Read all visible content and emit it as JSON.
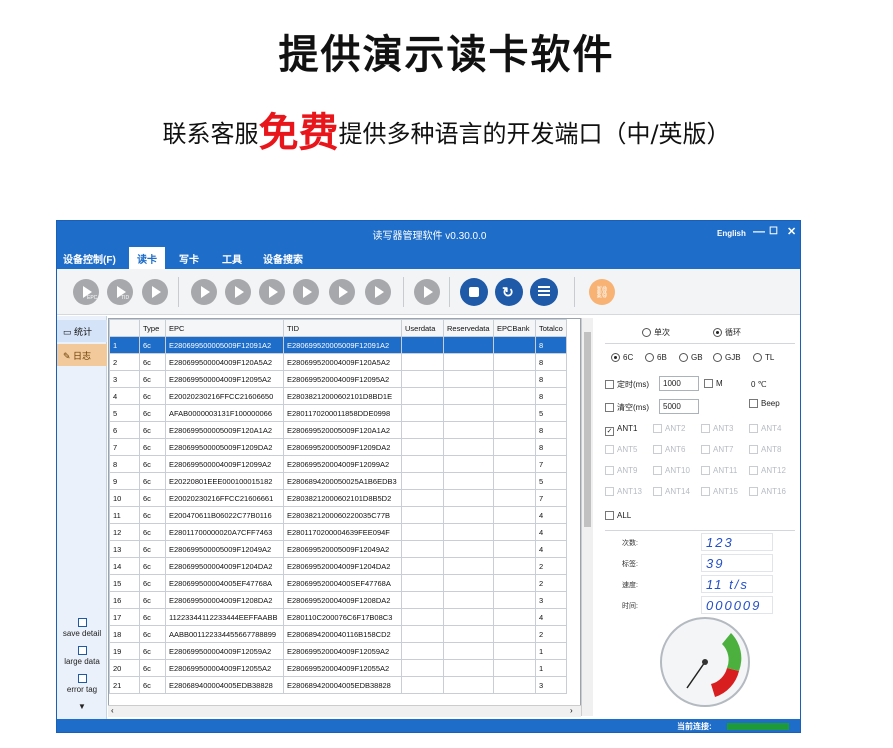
{
  "header": {
    "title": "提供演示读卡软件",
    "subtitle_pre": "联系客服",
    "subtitle_highlight": "免费",
    "subtitle_post": "提供多种语言的开发端口（中/英版）"
  },
  "window": {
    "title": "读写器管理软件 v0.30.0.0",
    "language": "English",
    "min": "—",
    "max": "☐",
    "close": "✕"
  },
  "menu": {
    "device_control": "设备控制(F)",
    "read": "读卡",
    "write": "写卡",
    "tools": "工具",
    "search": "设备搜索"
  },
  "toolbar": {
    "epc_label": "EPC",
    "tid_label": "TID"
  },
  "sidebar": {
    "stats": "统计",
    "log": "日志",
    "save_detail": "save detail",
    "large_data": "large data",
    "error_tag": "error tag"
  },
  "table": {
    "headers": [
      "",
      "Type",
      "EPC",
      "TID",
      "Userdata",
      "Reservedata",
      "EPCBank",
      "Totalco"
    ],
    "rows": [
      [
        "1",
        "6c",
        "E280699500005009F12091A2",
        "E280699520005009F12091A2",
        "8"
      ],
      [
        "2",
        "6c",
        "E280699500004009F120A5A2",
        "E280699520004009F120A5A2",
        "8"
      ],
      [
        "3",
        "6c",
        "E280699500004009F12095A2",
        "E280699520004009F12095A2",
        "8"
      ],
      [
        "4",
        "6c",
        "E20020230216FFCC21606650",
        "E28038212000602101D8BD1E",
        "8"
      ],
      [
        "5",
        "6c",
        "AFAB0000003131F100000066",
        "E2801170200011858DDE0998",
        "5"
      ],
      [
        "6",
        "6c",
        "E280699500005009F120A1A2",
        "E280699520005009F120A1A2",
        "8"
      ],
      [
        "7",
        "6c",
        "E280699500005009F1209DA2",
        "E280699520005009F1209DA2",
        "8"
      ],
      [
        "8",
        "6c",
        "E280699500004009F12099A2",
        "E280699520004009F12099A2",
        "7"
      ],
      [
        "9",
        "6c",
        "E20220801EEE000100015182",
        "E2806894200050025A1B6EDB3",
        "5"
      ],
      [
        "10",
        "6c",
        "E20020230216FFCC21606661",
        "E28038212000602101D8B5D2",
        "7"
      ],
      [
        "11",
        "6c",
        "E200470611B06022C77B0116",
        "E2803821200060220035C77B",
        "4"
      ],
      [
        "12",
        "6c",
        "E28011700000020A7CFF7463",
        "E2801170200004639FEE094F",
        "4"
      ],
      [
        "13",
        "6c",
        "E280699500005009F12049A2",
        "E280699520005009F12049A2",
        "4"
      ],
      [
        "14",
        "6c",
        "E280699500004009F1204DA2",
        "E280699520004009F1204DA2",
        "2"
      ],
      [
        "15",
        "6c",
        "E280699500004005EF47768A",
        "E28069952000400SEF47768A",
        "2"
      ],
      [
        "16",
        "6c",
        "E280699500004009F1208DA2",
        "E280699520004009F1208DA2",
        "3"
      ],
      [
        "17",
        "6c",
        "11223344112233444EEFFAABB",
        "E280110C200076C6F17B08C3",
        "4"
      ],
      [
        "18",
        "6c",
        "AABB001122334455667788899",
        "E2806894200040116B158CD2",
        "2"
      ],
      [
        "19",
        "6c",
        "E280699500004009F12059A2",
        "E280699520004009F12059A2",
        "1"
      ],
      [
        "20",
        "6c",
        "E280699500004009F12055A2",
        "E280699520004009F12055A2",
        "1"
      ],
      [
        "21",
        "6c",
        "E280689400004005EDB38828",
        "E280689420004005EDB38828",
        "3"
      ]
    ]
  },
  "panel": {
    "single": "单次",
    "loop": "循环",
    "protocols": [
      "6C",
      "6B",
      "GB",
      "GJB",
      "TL"
    ],
    "timed_label": "定时(ms)",
    "timed_value": "1000",
    "m_label": "M",
    "temp": "0 ℃",
    "clear_label": "清空(ms)",
    "clear_value": "5000",
    "beep": "Beep",
    "antennas": [
      "ANT1",
      "ANT2",
      "ANT3",
      "ANT4",
      "ANT5",
      "ANT6",
      "ANT7",
      "ANT8",
      "ANT9",
      "ANT10",
      "ANT11",
      "ANT12",
      "ANT13",
      "ANT14",
      "ANT15",
      "ANT16"
    ],
    "all": "ALL",
    "stats": [
      {
        "label": "次数:",
        "value": "123"
      },
      {
        "label": "标签:",
        "value": "39"
      },
      {
        "label": "速度:",
        "value": "11 t/s"
      },
      {
        "label": "时间:",
        "value": "000009"
      }
    ]
  },
  "status": {
    "connection": "当前连接:"
  }
}
